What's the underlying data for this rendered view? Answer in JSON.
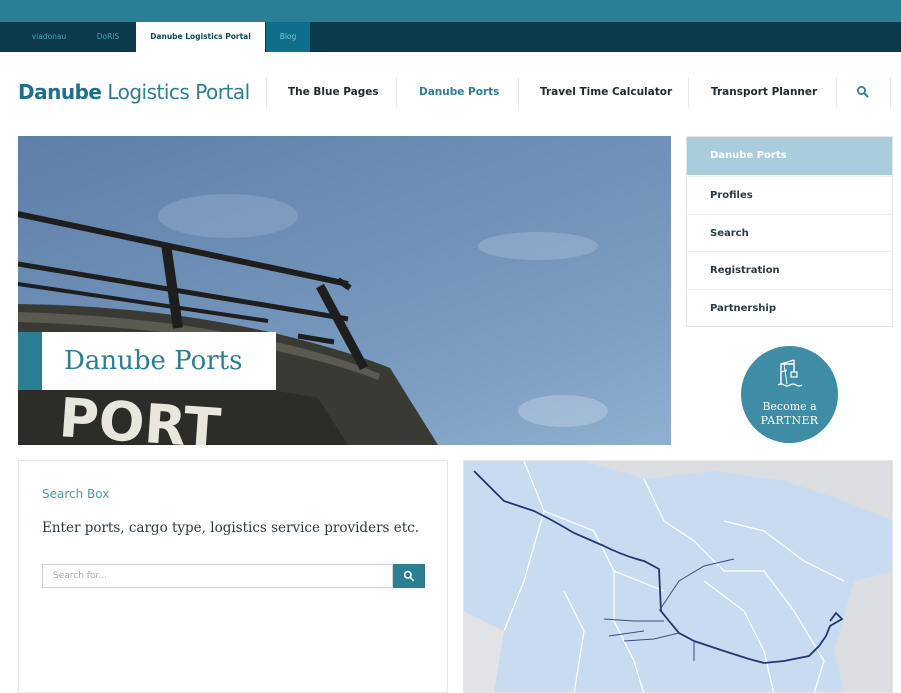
{
  "top_bar": {
    "tabs": [
      {
        "label": "viadonau"
      },
      {
        "label": "DoRIS"
      },
      {
        "label": "Danube Logistics Portal"
      },
      {
        "label": "Blog"
      }
    ]
  },
  "header": {
    "logo_strong": "Danube",
    "logo_rest": " Logistics Portal",
    "nav": [
      {
        "label": "The Blue Pages"
      },
      {
        "label": "Danube Ports"
      },
      {
        "label": "Travel Time Calculator"
      },
      {
        "label": "Transport Planner"
      }
    ],
    "search_icon": "search-icon"
  },
  "hero": {
    "title": "Danube Ports",
    "painted_text": "PORT"
  },
  "sidebar": {
    "items": [
      {
        "label": "Danube Ports"
      },
      {
        "label": "Profiles"
      },
      {
        "label": "Search"
      },
      {
        "label": "Registration"
      },
      {
        "label": "Partnership"
      }
    ]
  },
  "partner": {
    "line1": "Become a",
    "line2": "PARTNER",
    "icon": "crane-icon"
  },
  "search_box": {
    "heading": "Search Box",
    "description": "Enter ports, cargo type, logistics service providers etc.",
    "placeholder": "Search for...",
    "button_icon": "search-icon"
  },
  "colors": {
    "accent": "#2a7f95",
    "dark_bar": "#0b3a4a",
    "active_side": "#a9cddb",
    "river": "#23386e"
  }
}
